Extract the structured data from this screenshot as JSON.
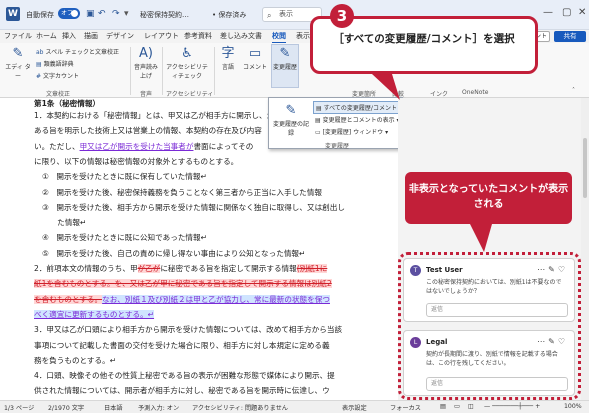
{
  "titlebar": {
    "autosave_label": "自動保存",
    "autosave_state": "オフ",
    "doc_title": "秘密保持契約…",
    "save_state": "• 保存済み",
    "search_placeholder": "検索",
    "search_text": "表示"
  },
  "tabs": [
    "ファイル",
    "ホーム",
    "挿入",
    "描画",
    "デザイン",
    "レイアウト",
    "参考資料",
    "差し込み文書",
    "校閲",
    "表示",
    "ヘルプ"
  ],
  "active_tab": "校閲",
  "header_buttons": {
    "comment": "コメント",
    "share": "共有"
  },
  "ribbon": {
    "editor": "エディ ター",
    "spell": "スペル チェックと文章校正",
    "thesaurus": "類義語辞典",
    "wordcount": "文字カウント",
    "group_proofing": "文章校正",
    "read_aloud": "音声読み上げ",
    "group_speech": "音声",
    "accessibility": "アクセシビリティチェック",
    "group_accessibility": "アクセシビリティ",
    "language": "言語",
    "comments": "コメント",
    "track_changes": "変更履歴",
    "group_changes": "変更箇所",
    "compare": "比較",
    "ink": "インク",
    "onenote": "OneNote"
  },
  "track_dropdown": {
    "record_label": "変更履歴の記録",
    "markup_option": "すべての変更履歴/コメント",
    "show_markup": "変更履歴とコメントの表示",
    "pane": "[変更履歴] ウィンドウ",
    "group": "変更履歴"
  },
  "document": {
    "heading": "第1条（秘密情報）",
    "lines": [
      {
        "t": "1．本契約における「秘密情報」とは、甲又は乙が相手方に開示し、かつ"
      },
      {
        "t": "ある旨を明示した技術上又は営業上の情報、本契約の存在及び内容"
      },
      {
        "t": "い。ただし、",
        "ins": "甲又は乙が開示を受けた当事者が",
        "t2": "書面によってその"
      },
      {
        "t": "に限り、以下の情報は秘密情報の対象外とするものとする。"
      },
      {
        "t": "①　開示を受けたときに既に保有していた情報↵"
      },
      {
        "t": "②　開示を受けた後、秘密保持義務を負うことなく第三者から正当に入手した情報"
      },
      {
        "t": "③　開示を受けた後、相手方から開示を受けた情報に関係なく独自に取得し、又は創出し"
      },
      {
        "t": "　　た情報↵"
      },
      {
        "t": "④　開示を受けたときに既に公知であった情報↵"
      },
      {
        "t": "⑤　開示を受けた後、自己の責めに帰し得ない事由により公知となった情報↵"
      },
      {
        "t": "2．前項本文の情報のうち、甲",
        "del": "が乙が",
        "t2": "に秘密である旨を指定して開示する情報",
        "del2": "(別紙1に"
      },
      {
        "del": "紙1を含むものとする。",
        "del2": "を、又は乙が甲に秘密である旨を指定して開示する情報は別紙2"
      },
      {
        "del": "を含むものとする。",
        "ins": "なお、別紙１及び別紙２は甲と乙が協力し、常に最新の状態を保つ"
      },
      {
        "ins": "べく適宜に更新するものとする。↵"
      },
      {
        "t": "3．甲又は乙が口頭により相手方から開示を受けた情報については、改めて相手方から当該"
      },
      {
        "t": "事項について記載した書面の交付を受けた場合に限り、相手方に対し本規定に定める義"
      },
      {
        "t": "務を負うものとする。↵"
      },
      {
        "t": "4．口頭、映像その他その性質上秘密である旨の表示が困難な形態で媒体により開示、提"
      },
      {
        "t": "供された情報については、開示者が相手方に対し、秘密である旨を開示時に伝達し、ウ"
      }
    ]
  },
  "comments": [
    {
      "user": "Test User",
      "initial": "T",
      "color": "#5b4fa0",
      "text": "この秘密保持契約においては、別紙1は不要なのではないでしょうか？",
      "reply": "返信"
    },
    {
      "user": "Legal",
      "initial": "L",
      "color": "#6a3d9a",
      "text": "契約が長期間に渡り、別紙で情報を記載する場合は、この行を残してください。",
      "reply": "返信"
    }
  ],
  "annotations": {
    "step_number": "3",
    "callout_main": "［すべての変更履歴/コメント］を選択",
    "callout_right": "非表示となっていたコメントが表示される"
  },
  "statusbar": {
    "page": "1/3 ページ",
    "words": "2/1970 文字",
    "lang": "日本語",
    "predict": "予測入力: オン",
    "access": "アクセシビリティ: 問題ありません",
    "display": "表示設定",
    "focus": "フォーカス",
    "zoom": "100%"
  },
  "colors": {
    "accent": "#185abd",
    "callout": "#c21f39",
    "insertion": "#7a2ad6",
    "deletion": "#d0202a"
  }
}
